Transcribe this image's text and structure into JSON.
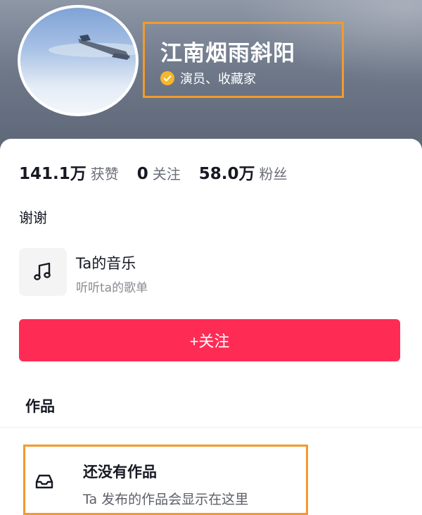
{
  "profile": {
    "name": "江南烟雨斜阳",
    "verification": "演员、收藏家",
    "bio": "谢谢"
  },
  "stats": {
    "likes_value": "141.1万",
    "likes_label": "获赞",
    "following_value": "0",
    "following_label": "关注",
    "followers_value": "58.0万",
    "followers_label": "粉丝"
  },
  "music": {
    "title": "Ta的音乐",
    "subtitle": "听听ta的歌单"
  },
  "actions": {
    "follow_label": "+关注"
  },
  "works": {
    "section_title": "作品",
    "empty_title": "还没有作品",
    "empty_subtitle": "Ta 发布的作品会显示在这里"
  },
  "colors": {
    "accent": "#fe2c55",
    "highlight_border": "#f39a2c",
    "verified_badge": "#f5b82a"
  }
}
